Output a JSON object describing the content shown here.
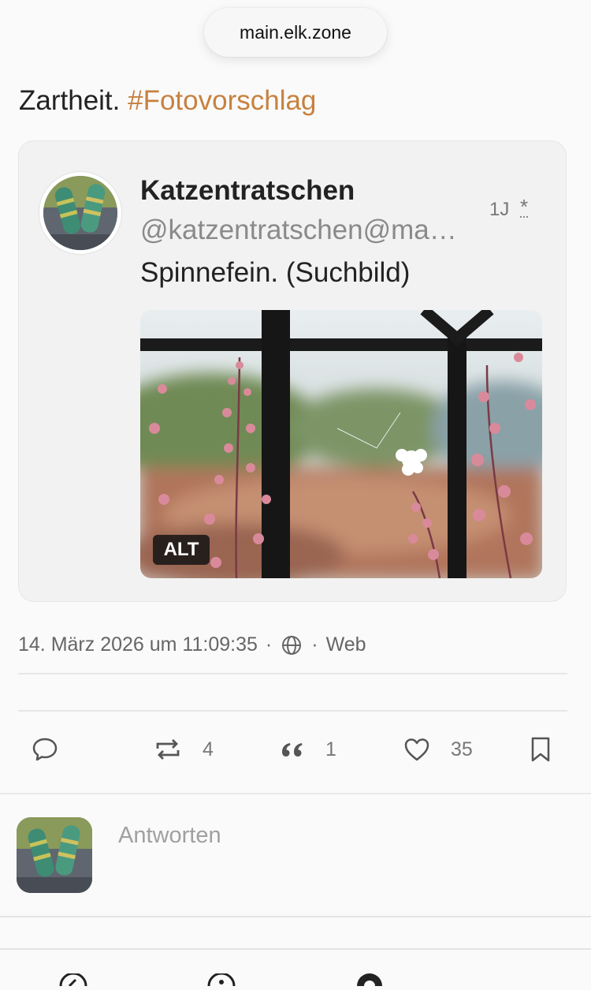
{
  "browser": {
    "url": "main.elk.zone"
  },
  "post": {
    "text": "Zartheit. ",
    "hashtag": "#Fotovorschlag",
    "timestamp": "14. März 2026 um 11:09:35",
    "separator": "·",
    "client": "Web"
  },
  "quoted": {
    "display_name": "Katzentratschen",
    "handle": "@katzentratschen@ma…",
    "relative_time": "1J",
    "visibility_marker": "*",
    "text": "Spinnefein. (Suchbild)",
    "alt_badge": "ALT"
  },
  "actions": {
    "reply_count": "",
    "boost_count": "4",
    "quote_count": "1",
    "favourite_count": "35"
  },
  "composer": {
    "placeholder": "Antworten"
  },
  "colors": {
    "hashtag": "#c7813f",
    "background": "#fafafa",
    "card": "#f2f2f2"
  },
  "icons": [
    "reply-icon",
    "boost-icon",
    "quote-icon",
    "favourite-icon",
    "bookmark-icon",
    "globe-icon",
    "compose-icon",
    "explore-icon",
    "federated-icon"
  ]
}
